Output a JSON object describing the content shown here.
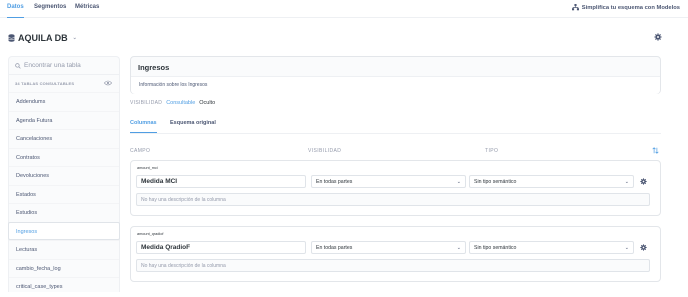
{
  "topnav": {
    "tabs": [
      "Datos",
      "Segmentos",
      "Métricas"
    ],
    "promo": "Simplifica tu esquema con Modelos"
  },
  "database": {
    "name": "AQUILA DB"
  },
  "sidebar": {
    "search_placeholder": "Encontrar una tabla",
    "table_count": "34 TABLAS CONSULTABLES",
    "items": [
      {
        "label": "Addendums"
      },
      {
        "label": "Agenda Futura"
      },
      {
        "label": "Cancelaciones"
      },
      {
        "label": "Contratos"
      },
      {
        "label": "Devoluciones"
      },
      {
        "label": "Estados"
      },
      {
        "label": "Estudios"
      },
      {
        "label": "Ingresos"
      },
      {
        "label": "Lecturas"
      },
      {
        "label": "cambio_fecha_log"
      },
      {
        "label": "critical_case_types"
      }
    ],
    "active_item": "Ingresos"
  },
  "table": {
    "title": "Ingresos",
    "description": "Información sobre los Ingresos",
    "visibility_label": "VISIBILIDAD",
    "visibility_options": [
      "Consultable",
      "Oculto"
    ],
    "visibility_selected": "Consultable"
  },
  "subtabs": [
    "Columnas",
    "Esquema original"
  ],
  "columns_header": {
    "field": "CAMPO",
    "visibility": "VISIBILIDAD",
    "type": "TIPO"
  },
  "fields": [
    {
      "field_name": "amount_mci",
      "display_name": "Medida MCI",
      "visibility": "En todas partes",
      "type": "Sin tipo semántico",
      "description_placeholder": "No hay una descripción de la columna"
    },
    {
      "field_name": "amount_qradiof",
      "display_name": "Medida QradioF",
      "visibility": "En todas partes",
      "type": "Sin tipo semántico",
      "description_placeholder": "No hay una descripción de la columna"
    }
  ],
  "colors": {
    "accent": "#509ee3",
    "text": "#4c5773",
    "muted": "#949aab"
  }
}
